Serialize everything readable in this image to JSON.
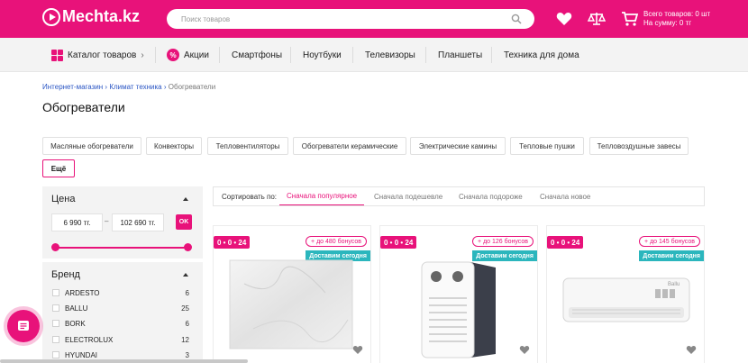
{
  "header": {
    "logo_text": "Mechta.kz",
    "search_placeholder": "Поиск товаров",
    "cart_line1": "Всего товаров: 0 шт",
    "cart_line2": "На сумму: 0 тг",
    "brand_color": "#e8127a"
  },
  "nav": {
    "catalog": "Каталог товаров",
    "promo": "Акции",
    "items": [
      "Смартфоны",
      "Ноутбуки",
      "Телевизоры",
      "Планшеты",
      "Техника для дома"
    ]
  },
  "breadcrumbs": [
    "Интернет-магазин",
    "Климат техника",
    "Обогреватели"
  ],
  "page_title": "Обогреватели",
  "categories": [
    "Масляные обогреватели",
    "Конвекторы",
    "Тепловентиляторы",
    "Обогреватели керамические",
    "Электрические камины",
    "Тепловые пушки",
    "Тепловоздушные завесы"
  ],
  "categories_more": "Ещё",
  "filters": {
    "price": {
      "title": "Цена",
      "min": "6 990 тг.",
      "separator": "–",
      "max": "102 690 тг.",
      "ok": "OK",
      "range_low": 0,
      "range_high": 1
    },
    "brand": {
      "title": "Бренд",
      "items": [
        {
          "name": "ARDESTO",
          "count": "6"
        },
        {
          "name": "BALLU",
          "count": "25"
        },
        {
          "name": "BORK",
          "count": "6"
        },
        {
          "name": "ELECTROLUX",
          "count": "12"
        },
        {
          "name": "HYUNDAI",
          "count": "3"
        }
      ]
    }
  },
  "sort": {
    "label": "Сортировать по:",
    "options": [
      "Сначала популярное",
      "Сначала подешевле",
      "Сначала подороже",
      "Сначала новое"
    ],
    "active_index": 0
  },
  "products": [
    {
      "badge": "0 • 0 • 24",
      "bonus": "+ до 480 бонусов",
      "delivery": "Доставим сегодня"
    },
    {
      "badge": "0 • 0 • 24",
      "bonus": "+ до 126 бонусов",
      "delivery": "Доставим сегодня"
    },
    {
      "badge": "0 • 0 • 24",
      "bonus": "+ до 145 бонусов",
      "delivery": "Доставим сегодня"
    }
  ],
  "product3_brand": "Ballu"
}
